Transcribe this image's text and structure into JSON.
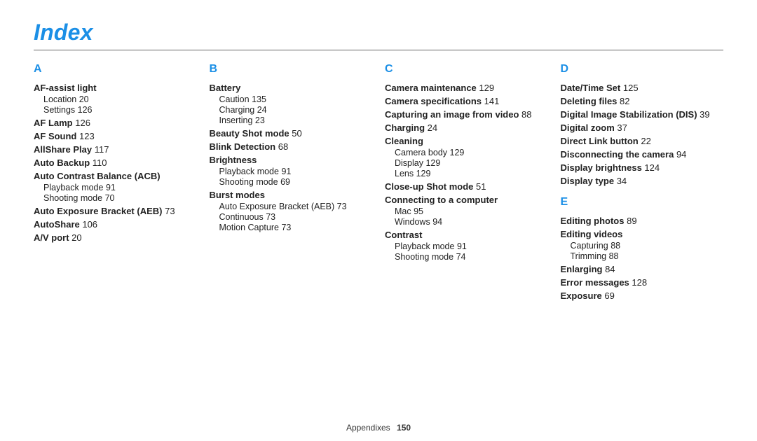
{
  "title": "Index",
  "footer": {
    "section": "Appendixes",
    "page": "150"
  },
  "columns": [
    {
      "sections": [
        {
          "letter": "A",
          "entries": [
            {
              "t": "AF-assist light",
              "subs": [
                {
                  "t": "Location",
                  "p": "20"
                },
                {
                  "t": "Settings",
                  "p": "126"
                }
              ]
            },
            {
              "t": "AF Lamp",
              "p": "126"
            },
            {
              "t": "AF Sound",
              "p": "123"
            },
            {
              "t": "AllShare Play",
              "p": "117"
            },
            {
              "t": "Auto Backup",
              "p": "110"
            },
            {
              "t": "Auto Contrast Balance (ACB)",
              "subs": [
                {
                  "t": "Playback mode",
                  "p": "91"
                },
                {
                  "t": "Shooting mode",
                  "p": "70"
                }
              ]
            },
            {
              "t": "Auto Exposure Bracket (AEB)",
              "p": "73"
            },
            {
              "t": "AutoShare",
              "p": "106"
            },
            {
              "t": "A/V port",
              "p": "20"
            }
          ]
        }
      ]
    },
    {
      "sections": [
        {
          "letter": "B",
          "entries": [
            {
              "t": "Battery",
              "subs": [
                {
                  "t": "Caution",
                  "p": "135"
                },
                {
                  "t": "Charging",
                  "p": "24"
                },
                {
                  "t": "Inserting",
                  "p": "23"
                }
              ]
            },
            {
              "t": "Beauty Shot mode",
              "p": "50"
            },
            {
              "t": "Blink Detection",
              "p": "68"
            },
            {
              "t": "Brightness",
              "subs": [
                {
                  "t": "Playback mode",
                  "p": "91"
                },
                {
                  "t": "Shooting mode",
                  "p": "69"
                }
              ]
            },
            {
              "t": "Burst modes",
              "subs": [
                {
                  "t": "Auto Exposure Bracket (AEB)",
                  "p": "73"
                },
                {
                  "t": "Continuous",
                  "p": "73"
                },
                {
                  "t": "Motion Capture",
                  "p": "73"
                }
              ]
            }
          ]
        }
      ]
    },
    {
      "sections": [
        {
          "letter": "C",
          "entries": [
            {
              "t": "Camera maintenance",
              "p": "129"
            },
            {
              "t": "Camera specifications",
              "p": "141"
            },
            {
              "t": "Capturing an image from video",
              "p": "88"
            },
            {
              "t": "Charging",
              "p": "24"
            },
            {
              "t": "Cleaning",
              "subs": [
                {
                  "t": "Camera body",
                  "p": "129"
                },
                {
                  "t": "Display",
                  "p": "129"
                },
                {
                  "t": "Lens",
                  "p": "129"
                }
              ]
            },
            {
              "t": "Close-up Shot mode",
              "p": "51"
            },
            {
              "t": "Connecting to a computer",
              "subs": [
                {
                  "t": "Mac",
                  "p": "95"
                },
                {
                  "t": "Windows",
                  "p": "94"
                }
              ]
            },
            {
              "t": "Contrast",
              "subs": [
                {
                  "t": "Playback mode",
                  "p": "91"
                },
                {
                  "t": "Shooting mode",
                  "p": "74"
                }
              ]
            }
          ]
        }
      ]
    },
    {
      "sections": [
        {
          "letter": "D",
          "entries": [
            {
              "t": "Date/Time Set",
              "p": "125"
            },
            {
              "t": "Deleting files",
              "p": "82"
            },
            {
              "t": "Digital Image Stabilization (DIS)",
              "p": "39"
            },
            {
              "t": "Digital zoom",
              "p": "37"
            },
            {
              "t": "Direct Link button",
              "p": "22"
            },
            {
              "t": "Disconnecting the camera",
              "p": "94"
            },
            {
              "t": "Display brightness",
              "p": "124"
            },
            {
              "t": "Display type",
              "p": "34"
            }
          ]
        },
        {
          "letter": "E",
          "entries": [
            {
              "t": "Editing photos",
              "p": "89"
            },
            {
              "t": "Editing videos",
              "subs": [
                {
                  "t": "Capturing",
                  "p": "88"
                },
                {
                  "t": "Trimming",
                  "p": "88"
                }
              ]
            },
            {
              "t": "Enlarging",
              "p": "84"
            },
            {
              "t": "Error messages",
              "p": "128"
            },
            {
              "t": "Exposure",
              "p": "69"
            }
          ]
        }
      ]
    }
  ]
}
